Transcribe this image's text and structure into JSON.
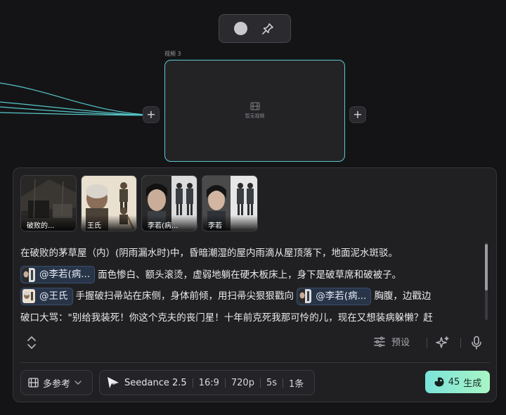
{
  "node": {
    "title": "视频 3",
    "empty_label": "暂无视频"
  },
  "references": [
    {
      "label": "破败的..."
    },
    {
      "label": "王氏"
    },
    {
      "label": "李若(病..."
    },
    {
      "label": "李若"
    }
  ],
  "prompt": {
    "line1": "在破败的茅草屋（内）(阴雨漏水时)中，昏暗潮湿的屋内雨滴从屋顶落下，地面泥水斑驳。",
    "mention1": "@李若(病...",
    "line2_text": "面色惨白、额头滚烫，虚弱地躺在硬木板床上，身下是破草席和破被子。",
    "mention2": "@王氏",
    "line3_text": "手握破扫帚站在床侧，身体前倾，用扫帚尖狠狠戳向",
    "mention3": "@李若(病...",
    "line3_tail": "胸腹，边戳边",
    "line4": "破口大骂：\"别给我装死！你这个克夫的丧门星！十年前克死我那可怜的儿，现在又想装病躲懒？赶"
  },
  "toolbar": {
    "preset_label": "预设"
  },
  "controls": {
    "reference_mode": "多参考",
    "model": "Seedance 2.5",
    "ratio": "16:9",
    "resolution": "720p",
    "duration": "5s",
    "count": "1条",
    "generate_cost": "45",
    "generate_label": "生成"
  },
  "colors": {
    "node_border": "#5ac8cc",
    "generate_gradient_start": "#7be3da",
    "generate_gradient_end": "#a8f5c4",
    "mention_bg": "#283448"
  },
  "icons": [
    "record-icon",
    "pin-icon",
    "film-icon",
    "plus-icon",
    "expand-vertical-icon",
    "sliders-icon",
    "sparkle-icon",
    "microphone-icon",
    "film-icon",
    "chevron-down-icon",
    "seedance-logo-icon",
    "bean-icon"
  ]
}
